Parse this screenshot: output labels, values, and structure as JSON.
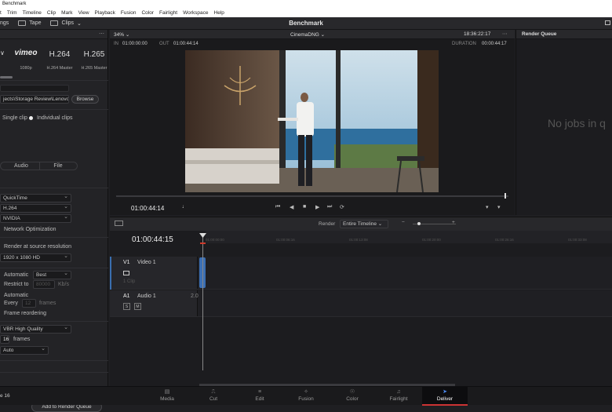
{
  "window": {
    "title": "Benchmark"
  },
  "menu": [
    "t",
    "Trim",
    "Timeline",
    "Clip",
    "Mark",
    "View",
    "Playback",
    "Fusion",
    "Color",
    "Fairlight",
    "Workspace",
    "Help"
  ],
  "toolbar": {
    "left_label": "ngs",
    "tape_label": "Tape",
    "clips_label": "Clips",
    "project_title": "Benchmark"
  },
  "presets": {
    "items": [
      {
        "logo": "vimeo",
        "caption": "1080p"
      },
      {
        "logo": "H.264",
        "caption": "H.264 Master"
      },
      {
        "logo": "H.265",
        "caption": "H.265 Master"
      }
    ],
    "partial_logo": "∨"
  },
  "render_settings": {
    "location": "jects\\Storage Review\\Lenovo P",
    "browse": "Browse",
    "single_clip": "Single clip",
    "individual_clips": "Individual clips",
    "tab_audio": "Audio",
    "tab_file": "File",
    "format": "QuickTime",
    "codec": "H.264",
    "encoder": "NVIDIA",
    "network_opt": "Network Optimization",
    "render_at_source": "Render at source resolution",
    "resolution": "1920 x 1080 HD",
    "quality_label": "Automatic",
    "quality_value": "Best",
    "restrict_label": "Restrict to",
    "restrict_value": "80000",
    "restrict_unit": "Kb/s",
    "keyframes_label": "Automatic",
    "every_label": "Every",
    "every_value": "12",
    "every_unit": "frames",
    "frame_reordering": "Frame reordering",
    "profile": "VBR High Quality",
    "frames_value": "16",
    "frames_unit": "frames",
    "auto": "Auto",
    "add_to_queue": "Add to Render Queue"
  },
  "viewer": {
    "zoom": "34%",
    "clip_name": "CinemaDNG",
    "timecode_top": "18:36:22:17",
    "in_label": "IN",
    "in_value": "01:00:00:00",
    "out_label": "OUT",
    "out_value": "01:00:44:14",
    "duration_label": "DURATION",
    "duration_value": "00:00:44:17",
    "current_timecode": "01:00:44:14"
  },
  "render_queue": {
    "title": "Render Queue",
    "empty_text": "No jobs in q"
  },
  "timeline": {
    "render_label": "Render",
    "render_range": "Entire Timeline",
    "timecode": "01:00:44:15",
    "ruler_ticks": [
      "01:00:00:00",
      "01:00:06:16",
      "01:00:13:08",
      "01:00:20:00",
      "01:00:26:16",
      "01:00:33:08",
      "01:00:40:00"
    ],
    "video_track": {
      "id": "V1",
      "name": "Video 1",
      "clips": "1 Clip"
    },
    "audio_track": {
      "id": "A1",
      "name": "Audio 1",
      "channels": "2.0",
      "solo": "S",
      "mute": "M"
    }
  },
  "pages": [
    {
      "label": "Media",
      "icon": "media-icon"
    },
    {
      "label": "Cut",
      "icon": "cut-icon"
    },
    {
      "label": "Edit",
      "icon": "edit-icon"
    },
    {
      "label": "Fusion",
      "icon": "fusion-icon"
    },
    {
      "label": "Color",
      "icon": "color-icon"
    },
    {
      "label": "Fairlight",
      "icon": "fairlight-icon"
    },
    {
      "label": "Deliver",
      "icon": "deliver-icon",
      "active": true
    }
  ],
  "status": {
    "version": "e 16"
  },
  "colors": {
    "accent": "#4d8ef7",
    "active_marker": "#cc3333",
    "panel": "#232326"
  }
}
